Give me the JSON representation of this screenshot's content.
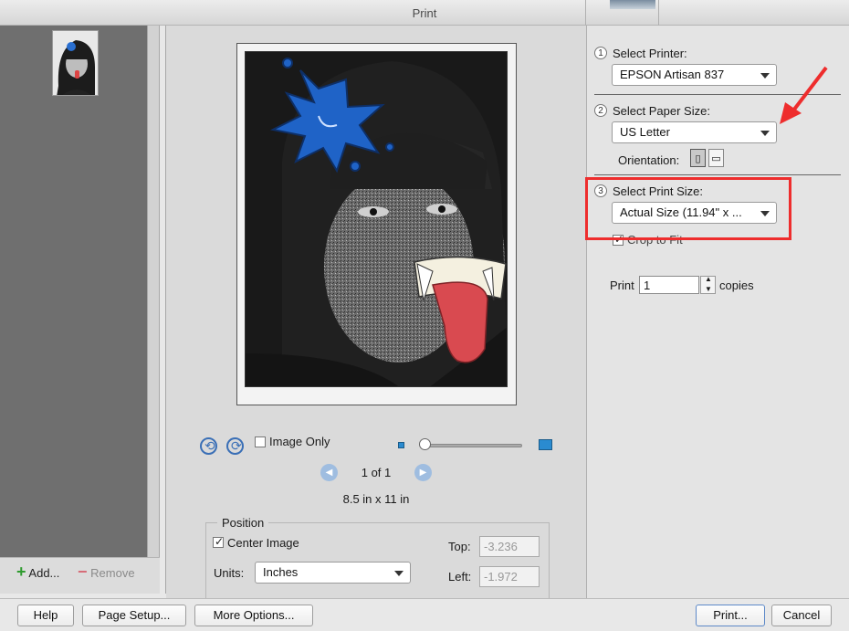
{
  "window": {
    "title": "Print"
  },
  "sidebar": {
    "add_label": "Add...",
    "remove_label": "Remove"
  },
  "preview": {
    "image_only_label": "Image Only",
    "page_indicator": "1 of 1",
    "paper_dims": "8.5 in x 11 in",
    "zoom_level": 0.0
  },
  "position": {
    "legend": "Position",
    "center_image_label": "Center Image",
    "center_image_checked": true,
    "units_label": "Units:",
    "units_value": "Inches",
    "top_label": "Top:",
    "top_value": "-3.236",
    "left_label": "Left:",
    "left_value": "-1.972"
  },
  "printer": {
    "step": "1",
    "label": "Select Printer:",
    "value": "EPSON Artisan 837"
  },
  "paper": {
    "step": "2",
    "label": "Select Paper Size:",
    "value": "US Letter",
    "orientation_label": "Orientation:"
  },
  "print_size": {
    "step": "3",
    "label": "Select Print Size:",
    "value": "Actual Size (11.94\" x ...",
    "crop_label": "Crop to Fit",
    "crop_checked": true
  },
  "copies": {
    "prefix": "Print",
    "value": "1",
    "suffix": "copies"
  },
  "buttons": {
    "help": "Help",
    "page_setup": "Page Setup...",
    "more_options": "More Options...",
    "print": "Print...",
    "cancel": "Cancel"
  },
  "colors": {
    "accent": "#3a6fb6",
    "annotation_red": "#ee2d2d"
  }
}
